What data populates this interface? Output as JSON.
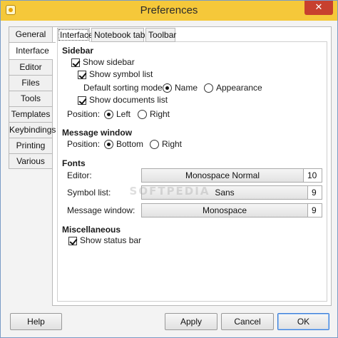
{
  "window": {
    "title": "Preferences",
    "close_label": "✕"
  },
  "side_tabs": [
    "General",
    "Interface",
    "Editor",
    "Files",
    "Tools",
    "Templates",
    "Keybindings",
    "Printing",
    "Various"
  ],
  "top_tabs": [
    "Interface",
    "Notebook tabs",
    "Toolbar"
  ],
  "sidebar": {
    "heading": "Sidebar",
    "show_sidebar": "Show sidebar",
    "show_symbol_list": "Show symbol list",
    "sorting_label": "Default sorting mode:",
    "sort_name": "Name",
    "sort_appearance": "Appearance",
    "show_documents_list": "Show documents list",
    "position_label": "Position:",
    "pos_left": "Left",
    "pos_right": "Right"
  },
  "message_window": {
    "heading": "Message window",
    "position_label": "Position:",
    "pos_bottom": "Bottom",
    "pos_right": "Right"
  },
  "fonts": {
    "heading": "Fonts",
    "editor_label": "Editor:",
    "editor_font": "Monospace Normal",
    "editor_size": "10",
    "symbol_label": "Symbol list:",
    "symbol_font": "Sans",
    "symbol_size": "9",
    "message_label": "Message window:",
    "message_font": "Monospace",
    "message_size": "9"
  },
  "misc": {
    "heading": "Miscellaneous",
    "show_status_bar": "Show status bar"
  },
  "buttons": {
    "help": "Help",
    "apply": "Apply",
    "cancel": "Cancel",
    "ok": "OK"
  },
  "watermark": "SOFTPEDIA"
}
